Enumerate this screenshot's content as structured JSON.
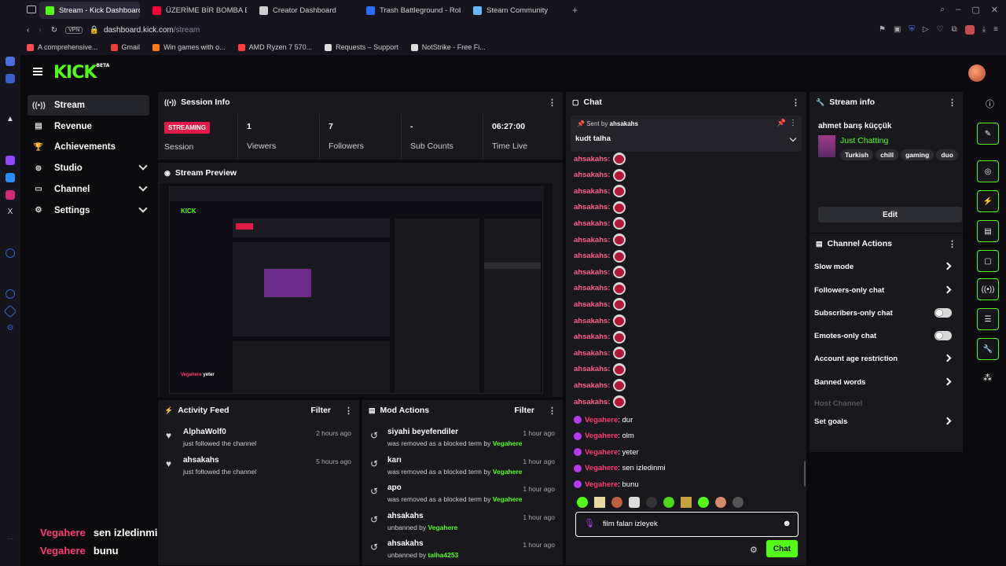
{
  "browser": {
    "tabs": [
      {
        "label": "Stream - Kick Dashboard",
        "color": "#53fc18",
        "active": true
      },
      {
        "label": "ÜZERİME BİR BOMBA BA…",
        "color": "#ff0033",
        "active": false
      },
      {
        "label": "Creator Dashboard",
        "color": "#cfcfcf",
        "active": false
      },
      {
        "label": "Trash Battleground - Rob…",
        "color": "#2c6bff",
        "active": false
      },
      {
        "label": "Steam Community",
        "color": "#66b7ff",
        "active": false
      }
    ],
    "new_tab": "+",
    "vpn": "VPN",
    "url_host": "dashboard.kick.com",
    "url_path": "/stream",
    "bookmarks": [
      {
        "label": "A comprehensive...",
        "color": "#ff4d4d"
      },
      {
        "label": "Gmail",
        "color": "#ea4335"
      },
      {
        "label": "Win games with o...",
        "color": "#ff7a1a"
      },
      {
        "label": "AMD Ryzen 7 570...",
        "color": "#ff3b3b"
      },
      {
        "label": "Requests – Support",
        "color": "#dddddd"
      },
      {
        "label": "NotStrike - Free Fi...",
        "color": "#dddddd"
      }
    ]
  },
  "kick": {
    "logo": "KICK",
    "logo_badge": "BETA",
    "nav": [
      {
        "label": "Stream",
        "icon": "stream-icon",
        "glyph": "((•))",
        "expand": false,
        "active": true
      },
      {
        "label": "Revenue",
        "icon": "revenue-icon",
        "glyph": "▤",
        "expand": false,
        "active": false
      },
      {
        "label": "Achievements",
        "icon": "trophy-icon",
        "glyph": "🏆",
        "expand": false,
        "active": false
      },
      {
        "label": "Studio",
        "icon": "studio-icon",
        "glyph": "⊚",
        "expand": true,
        "active": false
      },
      {
        "label": "Channel",
        "icon": "channel-icon",
        "glyph": "▭",
        "expand": true,
        "active": false
      },
      {
        "label": "Settings",
        "icon": "settings-icon",
        "glyph": "⚙",
        "expand": true,
        "active": false
      }
    ],
    "session": {
      "title": "Session Info",
      "status": "STREAMING",
      "status_label": "Session",
      "stats": [
        {
          "value": "1",
          "label": "Viewers"
        },
        {
          "value": "7",
          "label": "Followers"
        },
        {
          "value": "-",
          "label": "Sub Counts"
        },
        {
          "value": "06:27:00",
          "label": "Time Live"
        }
      ]
    },
    "preview": {
      "title": "Stream Preview"
    },
    "activity": {
      "title": "Activity Feed",
      "filter": "Filter",
      "items": [
        {
          "name": "AlphaWolf0",
          "sub": "just followed the channel",
          "time": "2 hours ago"
        },
        {
          "name": "ahsakahs",
          "sub": "just followed the channel",
          "time": "5 hours ago"
        }
      ]
    },
    "mod": {
      "title": "Mod Actions",
      "filter": "Filter",
      "items": [
        {
          "name": "siyahi beyefendiler",
          "sub": "was removed as a blocked term by ",
          "by": "Vegahere",
          "time": "1 hour ago"
        },
        {
          "name": "karı",
          "sub": "was removed as a blocked term by ",
          "by": "Vegahere",
          "time": "1 hour ago"
        },
        {
          "name": "apo",
          "sub": "was removed as a blocked term by ",
          "by": "Vegahere",
          "time": "1 hour ago"
        },
        {
          "name": "ahsakahs",
          "sub": "unbanned by ",
          "by": "Vegahere",
          "time": "1 hour ago"
        },
        {
          "name": "ahsakahs",
          "sub": "unbanned by ",
          "by": "talha4253",
          "time": "1 hour ago"
        }
      ]
    },
    "chat": {
      "title": "Chat",
      "pinned_by_label": "Sent by ",
      "pinned_by": "ahsakahs",
      "pinned_text": "kudt talha",
      "emote_user": "ahsakahs:",
      "emote_rows": 16,
      "messages": [
        {
          "user": "Vegahere",
          "text": ": dur"
        },
        {
          "user": "Vegahere",
          "text": ": olm"
        },
        {
          "user": "Vegahere",
          "text": ": yeter"
        },
        {
          "user": "Vegahere",
          "text": ": sen izledinmi"
        },
        {
          "user": "Vegahere",
          "text": ": bunu"
        }
      ],
      "input_value": "film falan izleyek",
      "send_label": "Chat"
    },
    "stream_info": {
      "title": "Stream info",
      "streamer": "ahmet barış küççük",
      "category": "Just Chatting",
      "tags": [
        "Turkish",
        "chill",
        "gaming",
        "duo"
      ],
      "edit_label": "Edit"
    },
    "channel_actions": {
      "title": "Channel Actions",
      "items": [
        {
          "label": "Slow mode",
          "type": "arrow"
        },
        {
          "label": "Followers-only chat",
          "type": "arrow"
        },
        {
          "label": "Subscribers-only chat",
          "type": "toggle"
        },
        {
          "label": "Emotes-only chat",
          "type": "toggle"
        },
        {
          "label": "Account age restriction",
          "type": "arrow"
        },
        {
          "label": "Banned words",
          "type": "arrow"
        },
        {
          "label": "Host Channel",
          "type": "disabled"
        },
        {
          "label": "Set goals",
          "type": "arrow"
        }
      ]
    },
    "overlay": [
      {
        "user": "Vegahere",
        "text": "sen izledinmi"
      },
      {
        "user": "Vegahere",
        "text": "bunu"
      }
    ]
  },
  "colors": {
    "accent": "#53fc18",
    "live": "#e01b4a",
    "username": "#ff3b72"
  }
}
